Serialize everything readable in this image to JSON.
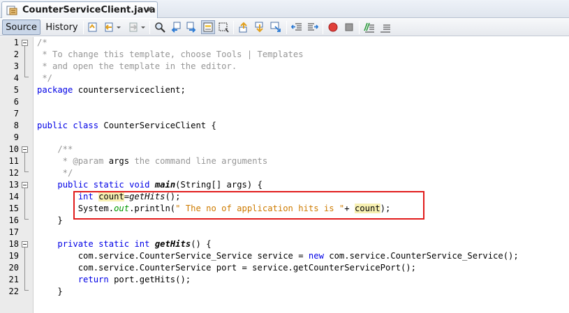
{
  "tab": {
    "title": "CounterServiceClient.java",
    "close": "⌘"
  },
  "toolbar": {
    "source_label": "Source",
    "history_label": "History"
  },
  "editor": {
    "lines": [
      {
        "n": "1",
        "text": "/*"
      },
      {
        "n": "2",
        "text": " * To change this template, choose Tools | Templates"
      },
      {
        "n": "3",
        "text": " * and open the template in the editor."
      },
      {
        "n": "4",
        "text": " */"
      },
      {
        "n": "5",
        "text": "package counterserviceclient;"
      },
      {
        "n": "6",
        "text": ""
      },
      {
        "n": "7",
        "text": ""
      },
      {
        "n": "8",
        "text": "public class CounterServiceClient {"
      },
      {
        "n": "9",
        "text": ""
      },
      {
        "n": "10",
        "text": "    /**"
      },
      {
        "n": "11",
        "text": "     * @param args the command line arguments"
      },
      {
        "n": "12",
        "text": "     */"
      },
      {
        "n": "13",
        "text": "    public static void main(String[] args) {"
      },
      {
        "n": "14",
        "text": "        int count=getHits();"
      },
      {
        "n": "15",
        "text": "        System.out.println(\" The no of application hits is \"+ count);"
      },
      {
        "n": "16",
        "text": "    }"
      },
      {
        "n": "17",
        "text": ""
      },
      {
        "n": "18",
        "text": "    private static int getHits() {"
      },
      {
        "n": "19",
        "text": "        com.service.CounterService_Service service = new com.service.CounterService_Service();"
      },
      {
        "n": "20",
        "text": "        com.service.CounterService port = service.getCounterServicePort();"
      },
      {
        "n": "21",
        "text": "        return port.getHits();"
      },
      {
        "n": "22",
        "text": "    }"
      }
    ]
  },
  "colors": {
    "keyword": "#0000e6",
    "comment": "#969696",
    "string": "#ce7b00",
    "static_field": "#009900",
    "highlight_box": "#e11b1b"
  }
}
